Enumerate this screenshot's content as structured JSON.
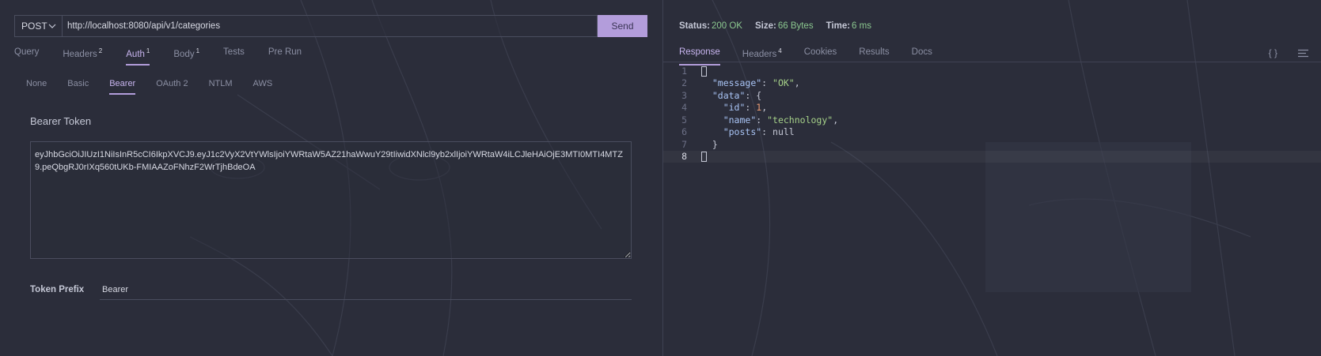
{
  "request": {
    "method": "POST",
    "url": "http://localhost:8080/api/v1/categories",
    "send_label": "Send",
    "tabs": [
      {
        "label": "Query",
        "badge": ""
      },
      {
        "label": "Headers",
        "badge": "2"
      },
      {
        "label": "Auth",
        "badge": "1"
      },
      {
        "label": "Body",
        "badge": "1"
      },
      {
        "label": "Tests",
        "badge": ""
      },
      {
        "label": "Pre Run",
        "badge": ""
      }
    ],
    "active_tab": "Auth"
  },
  "auth": {
    "tabs": [
      "None",
      "Basic",
      "Bearer",
      "OAuth 2",
      "NTLM",
      "AWS"
    ],
    "active_tab": "Bearer",
    "bearer_label": "Bearer Token",
    "token": "eyJhbGciOiJIUzI1NiIsInR5cCI6IkpXVCJ9.eyJ1c2VyX2VtYWlsIjoiYWRtaW5AZ21haWwuY29tIiwidXNlcl9yb2xlIjoiYWRtaW4iLCJleHAiOjE3MTI0MTI4MTZ9.peQbgRJ0rIXq560tUKb-FMIAAZoFNhzF2WrTjhBdeOA",
    "prefix_label": "Token Prefix",
    "prefix_value": "Bearer"
  },
  "response": {
    "status_label": "Status:",
    "status_value": "200 OK",
    "size_label": "Size:",
    "size_value": "66 Bytes",
    "time_label": "Time:",
    "time_value": "6 ms",
    "tabs": [
      {
        "label": "Response",
        "badge": ""
      },
      {
        "label": "Headers",
        "badge": "4"
      },
      {
        "label": "Cookies",
        "badge": ""
      },
      {
        "label": "Results",
        "badge": ""
      },
      {
        "label": "Docs",
        "badge": ""
      }
    ],
    "active_tab": "Response",
    "braces_icon": "{ }",
    "body": {
      "message_key": "\"message\"",
      "message_value": "\"OK\"",
      "data_key": "\"data\"",
      "id_key": "\"id\"",
      "id_value": "1",
      "name_key": "\"name\"",
      "name_value": "\"technology\"",
      "posts_key": "\"posts\"",
      "posts_value": "null"
    },
    "line_numbers": [
      "1",
      "2",
      "3",
      "4",
      "5",
      "6",
      "7",
      "8"
    ]
  },
  "colors": {
    "accent": "#b39ddb",
    "success": "#8bc78f",
    "background": "#2b2d3a"
  }
}
